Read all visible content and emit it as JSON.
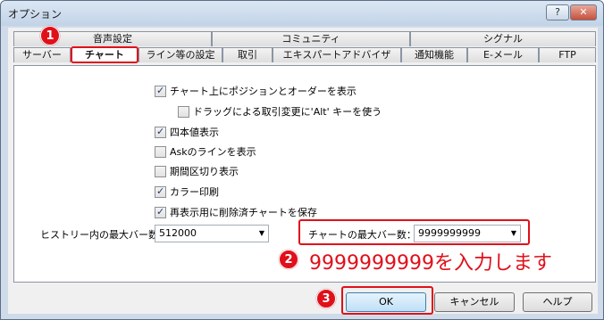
{
  "window": {
    "title": "オプション",
    "help_btn": "?",
    "close_btn": "✕"
  },
  "tabs": {
    "row_top": [
      "音声設定",
      "コミュニティ",
      "シグナル"
    ],
    "row_bottom": [
      "サーバー",
      "チャート",
      "ライン等の設定",
      "取引",
      "エキスパートアドバイザ",
      "通知機能",
      "E-メール",
      "FTP"
    ],
    "active": "チャート"
  },
  "options": [
    {
      "label": "チャート上にポジションとオーダーを表示",
      "checked": true
    },
    {
      "label": "ドラッグによる取引変更に'Alt' キーを使う",
      "checked": false
    },
    {
      "label": "四本値表示",
      "checked": true
    },
    {
      "label": "Askのラインを表示",
      "checked": false
    },
    {
      "label": "期間区切り表示",
      "checked": false
    },
    {
      "label": "カラー印刷",
      "checked": true
    },
    {
      "label": "再表示用に削除済チャートを保存",
      "checked": true
    }
  ],
  "history_bars": {
    "label": "ヒストリー内の最大バー数",
    "value": "512000"
  },
  "chart_bars": {
    "label": "チャートの最大バー数：",
    "value": "9999999999"
  },
  "annotations": {
    "step1": "1",
    "step2": "2",
    "step3": "3",
    "instruction": "9999999999を入力します"
  },
  "buttons": {
    "ok": "OK",
    "cancel": "キャンセル",
    "help": "ヘルプ"
  },
  "colors": {
    "highlight": "#e0101a",
    "ok_button": "#bfe0f6"
  }
}
